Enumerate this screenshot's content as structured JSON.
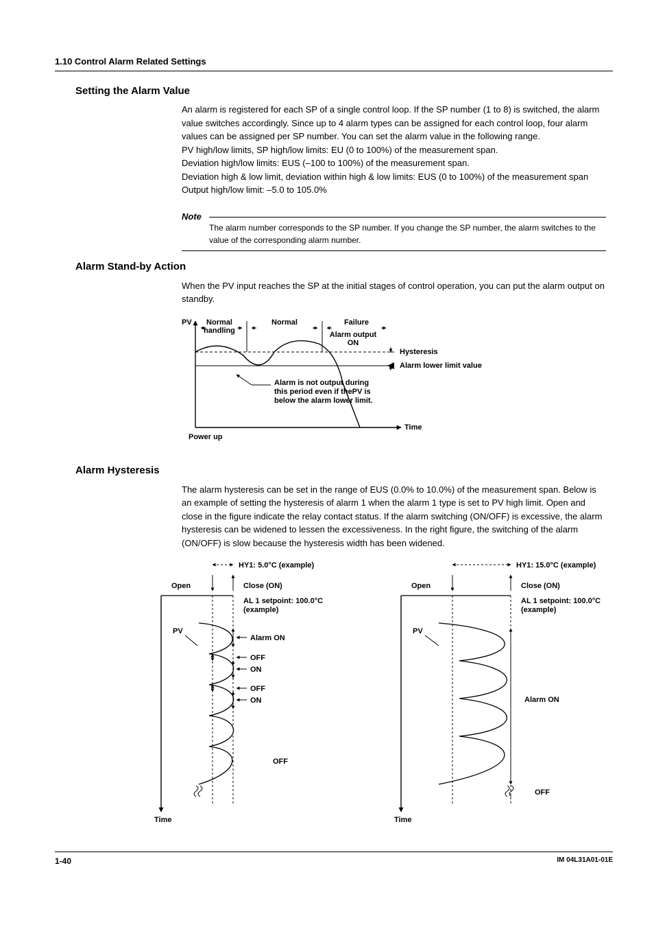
{
  "header": "1.10  Control Alarm Related Settings",
  "sections": {
    "alarmValue": {
      "title": "Setting the Alarm Value",
      "p1": "An alarm is registered for each SP of a single control loop.  If the SP number (1 to 8) is switched, the alarm value switches accordingly.  Since up to 4 alarm types can be assigned for each control loop, four alarm values can be assigned per SP number.  You can set the alarm value in the following range.",
      "l1": "PV high/low limits, SP high/low limits: EU (0 to 100%) of the measurement span.",
      "l2": "Deviation high/low limits: EUS (–100 to 100%) of the measurement span.",
      "l3": "Deviation high & low limit, deviation within high & low limits: EUS (0 to 100%) of the measurement span",
      "l4": "Output high/low limit: –5.0 to 105.0%",
      "noteTitle": "Note",
      "note": "The alarm number corresponds to the SP number.  If you change the SP number, the alarm switches to the value of the corresponding alarm number."
    },
    "standby": {
      "title": "Alarm Stand-by Action",
      "p1": "When the PV input reaches the SP at the initial stages of control operation, you can put the alarm output on standby."
    },
    "hysteresis": {
      "title": "Alarm Hysteresis",
      "p1": "The alarm hysteresis can be set in the range of EUS (0.0% to 10.0%) of the measurement span. Below is an example of setting the hysteresis of alarm 1 when the alarm 1 type is set to PV high limit.  Open and close in the figure indicate the relay contact status.  If the alarm switching (ON/OFF) is excessive, the alarm hysteresis can be widened to lessen the excessiveness.  In the right figure, the switching of the alarm (ON/OFF) is slow because the hysteresis width has been widened."
    }
  },
  "diag1": {
    "pv": "PV",
    "normalHandling1": "Normal",
    "normalHandling2": "handling",
    "normal": "Normal",
    "failure": "Failure",
    "alarmOutput": "Alarm output",
    "on": "ON",
    "hysteresis": "Hysteresis",
    "lowerLimit": "Alarm lower limit value",
    "noteLine1": "Alarm is not output during",
    "noteLine2": "this period even if thePV is",
    "noteLine3": "below the alarm lower limit.",
    "time": "Time",
    "powerUp": "Power up"
  },
  "diag2": {
    "leftHy": "HY1: 5.0°C (example)",
    "rightHy": "HY1: 15.0°C (example)",
    "open": "Open",
    "close": "Close (ON)",
    "setpoint1": "AL 1 setpoint: 100.0°C",
    "setpoint2": "(example)",
    "pv": "PV",
    "alarmOn": "Alarm ON",
    "off": "OFF",
    "on": "ON",
    "time": "Time"
  },
  "footer": {
    "page": "1-40",
    "docid": "IM 04L31A01-01E"
  }
}
